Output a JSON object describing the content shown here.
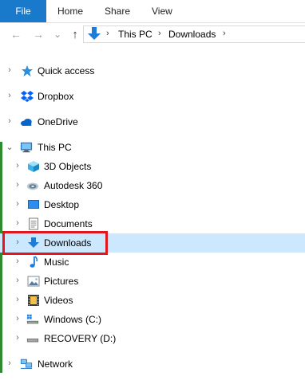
{
  "ribbon": {
    "file_label": "File",
    "home_label": "Home",
    "share_label": "Share",
    "view_label": "View"
  },
  "nav": {
    "back_glyph": "←",
    "forward_glyph": "→",
    "recent_glyph": "⌄",
    "up_glyph": "↑",
    "breadcrumb": [
      "This PC",
      "Downloads"
    ],
    "separator": "›"
  },
  "tree": {
    "quick_access": "Quick access",
    "dropbox": "Dropbox",
    "onedrive": "OneDrive",
    "this_pc": "This PC",
    "objects_3d": "3D Objects",
    "autodesk": "Autodesk 360",
    "desktop": "Desktop",
    "documents": "Documents",
    "downloads": "Downloads",
    "music": "Music",
    "pictures": "Pictures",
    "videos": "Videos",
    "windows_c": "Windows (C:)",
    "recovery_d": "RECOVERY (D:)",
    "network": "Network"
  },
  "colors": {
    "accent": "#1979ca",
    "selected_bg": "#cce8ff",
    "highlight_border": "#e0171f"
  }
}
